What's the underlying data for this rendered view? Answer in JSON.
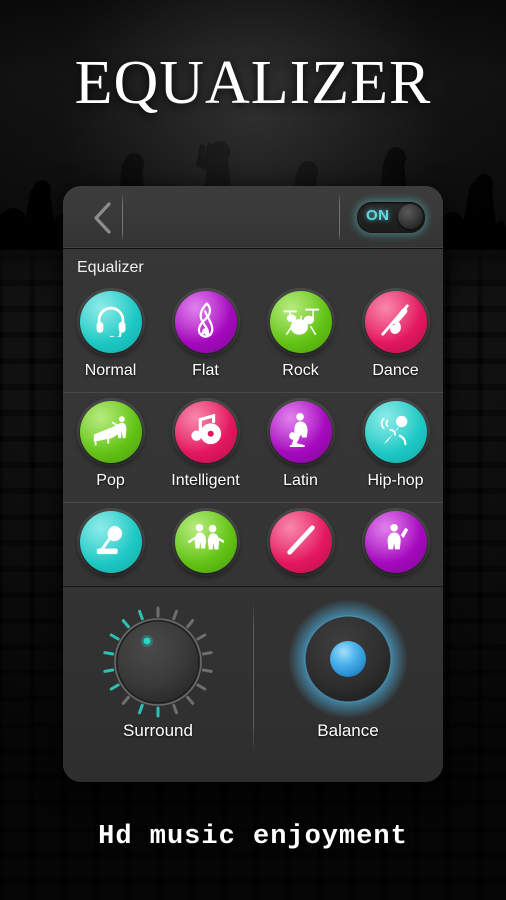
{
  "app": {
    "title": "EQUALIZER",
    "tagline": "Hd music enjoyment"
  },
  "topbar": {
    "back_icon": "back-chevron-icon",
    "toggle": {
      "label": "ON",
      "state": "on",
      "glow_color": "#50dcdc"
    }
  },
  "equalizer": {
    "section_label": "Equalizer",
    "rows": [
      {
        "presets": [
          {
            "label": "Normal",
            "color": "#1ec8c4",
            "icon": "headphones-icon"
          },
          {
            "label": "Flat",
            "color": "#a409bd",
            "icon": "treble-clef-icon"
          },
          {
            "label": "Rock",
            "color": "#62c315",
            "icon": "drum-kit-icon"
          },
          {
            "label": "Dance",
            "color": "#e3175e",
            "icon": "violin-icon"
          }
        ]
      },
      {
        "presets": [
          {
            "label": "Pop",
            "color": "#62c315",
            "icon": "piano-singer-icon"
          },
          {
            "label": "Intelligent",
            "color": "#e3175e",
            "icon": "note-disc-icon"
          },
          {
            "label": "Latin",
            "color": "#a409bd",
            "icon": "guitarist-icon"
          },
          {
            "label": "Hip-hop",
            "color": "#1ec8c4",
            "icon": "microphone-icon"
          }
        ]
      },
      {
        "presets": [
          {
            "label": "",
            "color": "#1ec8c4",
            "icon": "gramophone-icon"
          },
          {
            "label": "",
            "color": "#62c315",
            "icon": "duo-singers-icon"
          },
          {
            "label": "",
            "color": "#e3175e",
            "icon": "flute-icon"
          },
          {
            "label": "",
            "color": "#a409bd",
            "icon": "saxophone-icon"
          }
        ]
      }
    ]
  },
  "controls": {
    "surround": {
      "label": "Surround",
      "indicator_color": "#25d8c8",
      "tick_active_color": "#2ec0b4",
      "tick_inactive_color": "#6a6a6a"
    },
    "balance": {
      "label": "Balance",
      "ball_color": "#35a6e8",
      "glow_color": "#4fb8ea"
    }
  }
}
